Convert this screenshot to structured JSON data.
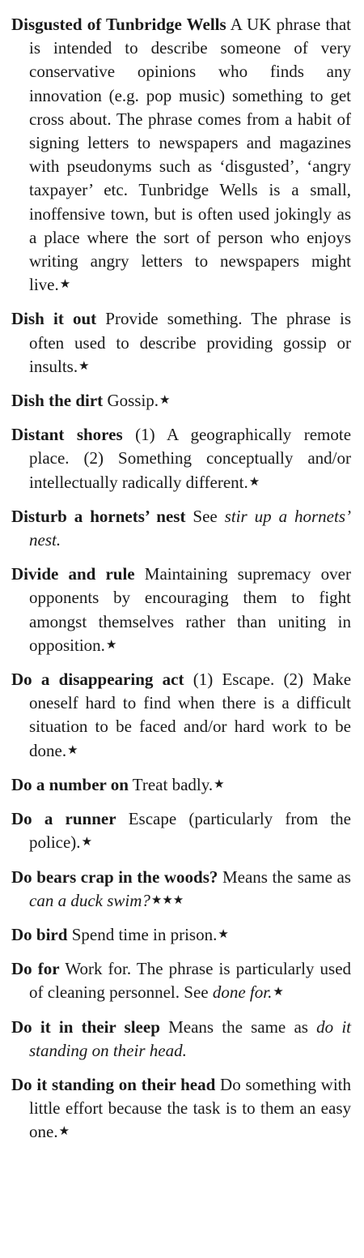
{
  "entries": [
    {
      "headword": "Disgusted of Tunbridge Wells",
      "text": "A UK phrase that is intended to describe someone of very conservative opinions who finds any innovation (e.g. pop music) something to get cross about. The phrase comes from a habit of signing letters to newspapers and magazines with pseudonyms such as ‘disgusted’, ‘angry taxpayer’ etc. Tunbridge Wells is a small, inoffensive town, but is often used jokingly as a place where the sort of person who enjoys writing angry letters to newspapers might live.",
      "rating": "★"
    },
    {
      "headword": "Dish it out",
      "text": "Provide something. The phrase is often used to describe providing gossip or insults.",
      "rating": "★"
    },
    {
      "headword": "Dish the dirt",
      "text": "Gossip.",
      "rating": "★"
    },
    {
      "headword": "Distant shores",
      "text": "(1) A geographically remote place. (2) Something conceptu­ally and/or intellectually radically differ­ent.",
      "rating": "★"
    },
    {
      "headword": "Disturb a hornets’ nest",
      "text": "See",
      "xref": "stir up a hornets’ nest.",
      "rating": ""
    },
    {
      "headword": "Divide and rule",
      "text": "Maintaining supremacy over opponents by encouraging them to fight amongst themselves rather than uniting in opposition.",
      "rating": "★"
    },
    {
      "headword": "Do a disappearing act",
      "text": "(1) Escape. (2) Make oneself hard to find when there is a difficult situation to be faced and/or hard work to be done.",
      "rating": "★"
    },
    {
      "headword": "Do a number on",
      "text": "Treat badly.",
      "rating": "★"
    },
    {
      "headword": "Do a runner",
      "text": "Escape (particularly from the police).",
      "rating": "★"
    },
    {
      "headword": "Do bears crap in the woods?",
      "text": "Means the same as",
      "xref": "can a duck swim?",
      "rating": "★★★"
    },
    {
      "headword": "Do bird",
      "text": "Spend time in prison.",
      "rating": "★"
    },
    {
      "headword": "Do for",
      "text": "Work for. The phrase is particularly used of cleaning personnel. See",
      "xref": "done for.",
      "rating": "★"
    },
    {
      "headword": "Do it in their sleep",
      "text": "Means the same as",
      "xref": "do it standing on their head.",
      "rating": ""
    },
    {
      "headword": "Do it standing on their head",
      "text": "Do some­thing with little effort because the task is to them an easy one.",
      "rating": "★"
    }
  ]
}
